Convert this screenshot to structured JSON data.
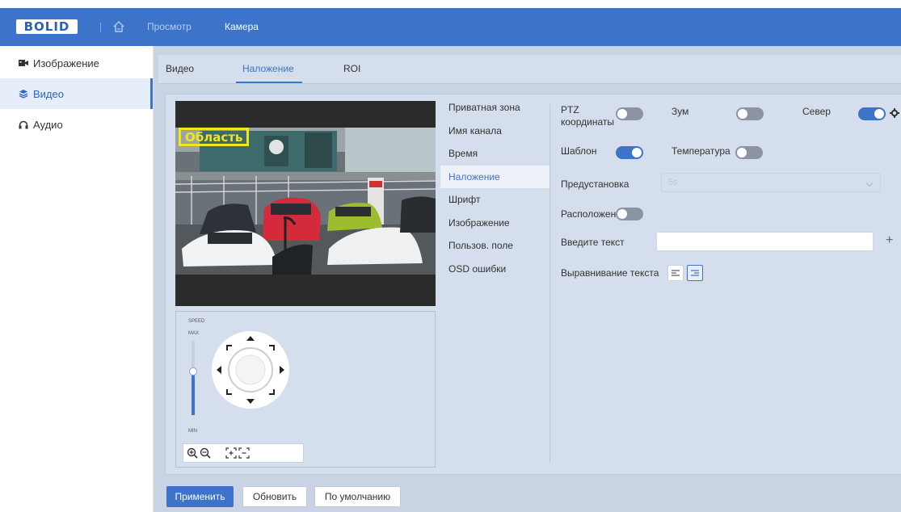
{
  "header": {
    "logo": "BOLID",
    "nav": [
      "Просмотр",
      "Камера"
    ]
  },
  "sidebar": {
    "items": [
      {
        "label": "Изображение",
        "icon": "camera-icon"
      },
      {
        "label": "Видео",
        "icon": "layers-icon"
      },
      {
        "label": "Аудио",
        "icon": "headphones-icon"
      }
    ],
    "active": 1
  },
  "tabs": [
    {
      "label": "Видео"
    },
    {
      "label": "Наложение"
    },
    {
      "label": "ROI"
    }
  ],
  "video": {
    "overlay_label": "Область"
  },
  "ptz": {
    "speed_label": "SPEED",
    "max_label": "MAX",
    "min_label": "MIN"
  },
  "menu": {
    "items": [
      "Приватная зона",
      "Имя канала",
      "Время",
      "Наложение",
      "Шрифт",
      "Изображение",
      "Пользов. поле",
      "OSD ошибки"
    ],
    "active": 3
  },
  "form": {
    "ptz_label": "PTZ координаты",
    "zoom_label": "Зум",
    "north_label": "Север",
    "template_label": "Шаблон",
    "temperature_label": "Температура",
    "preset_label": "Предустановка",
    "preset_value": "5s",
    "position_label": "Расположение",
    "text_label": "Введите текст",
    "text_value": "",
    "align_label": "Выравнивание текста",
    "toggles": {
      "ptz": false,
      "zoom": false,
      "north": true,
      "template": true,
      "temperature": false,
      "position": false
    }
  },
  "buttons": {
    "apply": "Применить",
    "refresh": "Обновить",
    "default": "По умолчанию"
  },
  "colors": {
    "accent": "#3d73c8",
    "panel": "#d5deec",
    "overlay": "#f1e61c"
  }
}
